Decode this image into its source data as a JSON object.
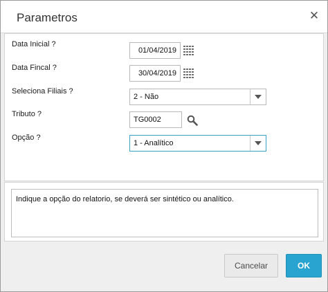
{
  "dialog": {
    "title": "Parametros",
    "close_symbol": "✕"
  },
  "form": {
    "data_inicial": {
      "label": "Data Inicial ?",
      "value": "01/04/2019",
      "icon": "calendar-icon"
    },
    "data_final": {
      "label": "Data Fincal ?",
      "value": "30/04/2019",
      "icon": "calendar-icon"
    },
    "filiais": {
      "label": "Seleciona Filiais ?",
      "selected": "2 - Não"
    },
    "tributo": {
      "label": "Tributo ?",
      "value": "TG0002",
      "icon": "search-icon"
    },
    "opcao": {
      "label": "Opção ?",
      "selected": "1 - Analítico"
    }
  },
  "help": {
    "text": "Indique a opção do relatorio, se deverá ser sintético ou analítico."
  },
  "buttons": {
    "cancel_label": "Cancelar",
    "ok_label": "OK"
  },
  "colors": {
    "accent": "#29a3cf",
    "focus_border": "#3aa0c6"
  }
}
